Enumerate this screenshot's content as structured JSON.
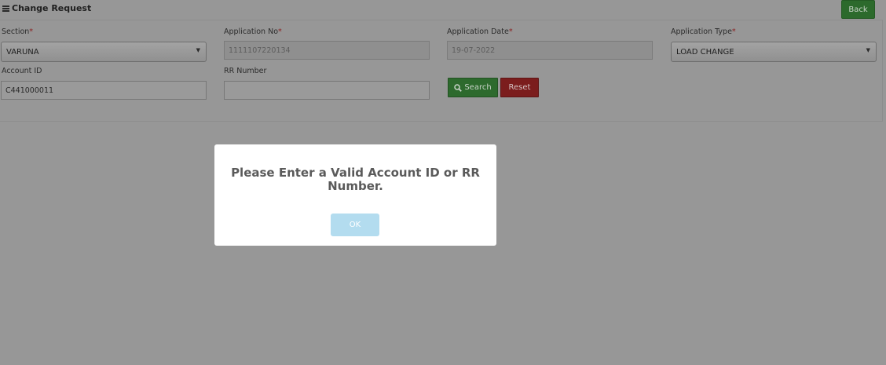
{
  "header": {
    "title": "Change Request",
    "back_label": "Back"
  },
  "form": {
    "section": {
      "label": "Section",
      "required": "*",
      "value": "VARUNA"
    },
    "application_no": {
      "label": "Application No",
      "required": "*",
      "value": "1111107220134"
    },
    "application_date": {
      "label": "Application Date",
      "required": "*",
      "value": "19-07-2022"
    },
    "application_type": {
      "label": "Application Type",
      "required": "*",
      "value": "LOAD CHANGE"
    },
    "account_id": {
      "label": "Account ID",
      "value": "C441000011"
    },
    "rr_number": {
      "label": "RR Number",
      "value": ""
    },
    "search_label": "Search",
    "reset_label": "Reset"
  },
  "dialog": {
    "message": "Please Enter a Valid Account ID or RR Number.",
    "ok_label": "OK"
  },
  "icons": {
    "menu": "menu-icon",
    "search": "search-icon",
    "dropdown": "chevron-down-icon"
  },
  "colors": {
    "overlay": "#979797",
    "success_button": "#2d6a2d",
    "danger_button": "#7b1d1d",
    "required_marker": "#8a1f1f",
    "ok_button": "#b3dcef"
  }
}
